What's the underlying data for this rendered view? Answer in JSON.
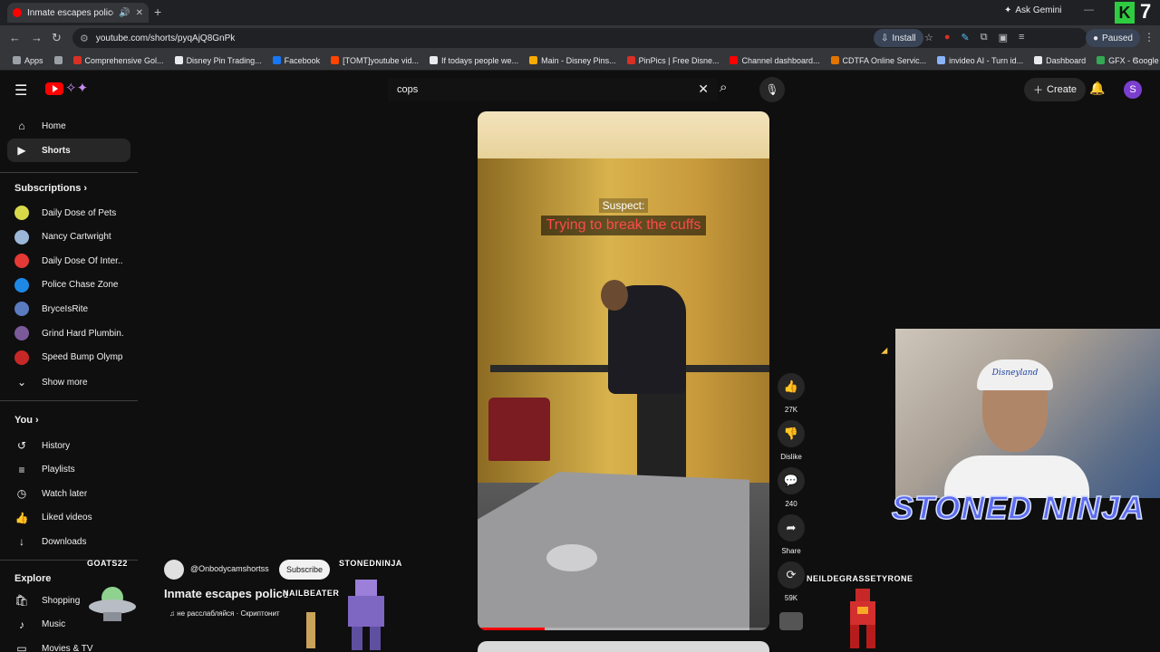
{
  "browser": {
    "tab_title": "Inmate escapes police with",
    "new_tab": "+",
    "gemini_label": "Ask Gemini",
    "url": "youtube.com/shorts/pyqAjQ8GnPk",
    "install_label": "Install",
    "profile_status": "Paused",
    "stream_counter": "7",
    "bookmarks": [
      {
        "label": "Apps",
        "color": "#9aa0a6"
      },
      {
        "label": "",
        "color": "#9aa0a6"
      },
      {
        "label": "Comprehensive Gol...",
        "color": "#d93025"
      },
      {
        "label": "Disney Pin Trading...",
        "color": "#e8eaed"
      },
      {
        "label": "Facebook",
        "color": "#1877f2"
      },
      {
        "label": "[TOMT]youtube vid...",
        "color": "#ff4500"
      },
      {
        "label": "If todays people we...",
        "color": "#e8eaed"
      },
      {
        "label": "Main - Disney Pins...",
        "color": "#f9ab00"
      },
      {
        "label": "PinPics | Free Disne...",
        "color": "#d93025"
      },
      {
        "label": "Channel dashboard...",
        "color": "#ff0000"
      },
      {
        "label": "CDTFA Online Servic...",
        "color": "#e37400"
      },
      {
        "label": "invideo AI - Turn id...",
        "color": "#8ab4f8"
      },
      {
        "label": "Dashboard",
        "color": "#e8eaed"
      },
      {
        "label": "GFX - Google Drive",
        "color": "#34a853"
      }
    ]
  },
  "youtube": {
    "search_value": "cops",
    "create_label": "Create",
    "avatar_letter": "S"
  },
  "sidebar": {
    "main": [
      {
        "label": "Home",
        "icon": "⌂"
      },
      {
        "label": "Shorts",
        "icon": "▶"
      }
    ],
    "subscriptions_heading": "Subscriptions",
    "subscriptions": [
      {
        "label": "Daily Dose of Pets",
        "color": "#d7d94a"
      },
      {
        "label": "Nancy Cartwright",
        "color": "#9cb8d8"
      },
      {
        "label": "Daily Dose Of Inter...",
        "color": "#e53935"
      },
      {
        "label": "Police Chase Zone",
        "color": "#1e88e5"
      },
      {
        "label": "BryceIsRite",
        "color": "#5a7bbf"
      },
      {
        "label": "Grind Hard Plumbin...",
        "color": "#7b5a9a"
      },
      {
        "label": "Speed Bump Olymp...",
        "color": "#c62828"
      }
    ],
    "show_more": "Show more",
    "you_heading": "You",
    "you_items": [
      {
        "label": "History",
        "icon": "↺"
      },
      {
        "label": "Playlists",
        "icon": "≡"
      },
      {
        "label": "Watch later",
        "icon": "◷"
      },
      {
        "label": "Liked videos",
        "icon": "👍"
      },
      {
        "label": "Downloads",
        "icon": "↓"
      }
    ],
    "explore_heading": "Explore",
    "explore_items": [
      {
        "label": "Shopping",
        "icon": "🛍"
      },
      {
        "label": "Music",
        "icon": "♪"
      },
      {
        "label": "Movies & TV",
        "icon": "▭"
      }
    ]
  },
  "short": {
    "caption_line1": "Suspect:",
    "caption_line2": "Trying to break the cuffs",
    "progress": 0.23,
    "channel_handle": "@Onbodycamshortss",
    "subscribe_label": "Subscribe",
    "title": "Inmate escapes police",
    "music": "не расслабляйся · Скриптонит",
    "actions": [
      {
        "name": "like",
        "icon": "👍",
        "label": "27K"
      },
      {
        "name": "dislike",
        "icon": "👎",
        "label": "Dislike"
      },
      {
        "name": "comments",
        "icon": "💬",
        "label": "240"
      },
      {
        "name": "share",
        "icon": "➦",
        "label": "Share"
      },
      {
        "name": "remix",
        "icon": "⟳",
        "label": "59K"
      }
    ]
  },
  "overlay": {
    "tags": {
      "goats": "GOATS22",
      "nailbeater": "NAILBEATER",
      "stoned_small": "STONEDNINJA",
      "neil": "NEILDEGRASSETYRONE"
    },
    "cap_text": "Disneyland",
    "big_title": "STONED NINJA"
  }
}
